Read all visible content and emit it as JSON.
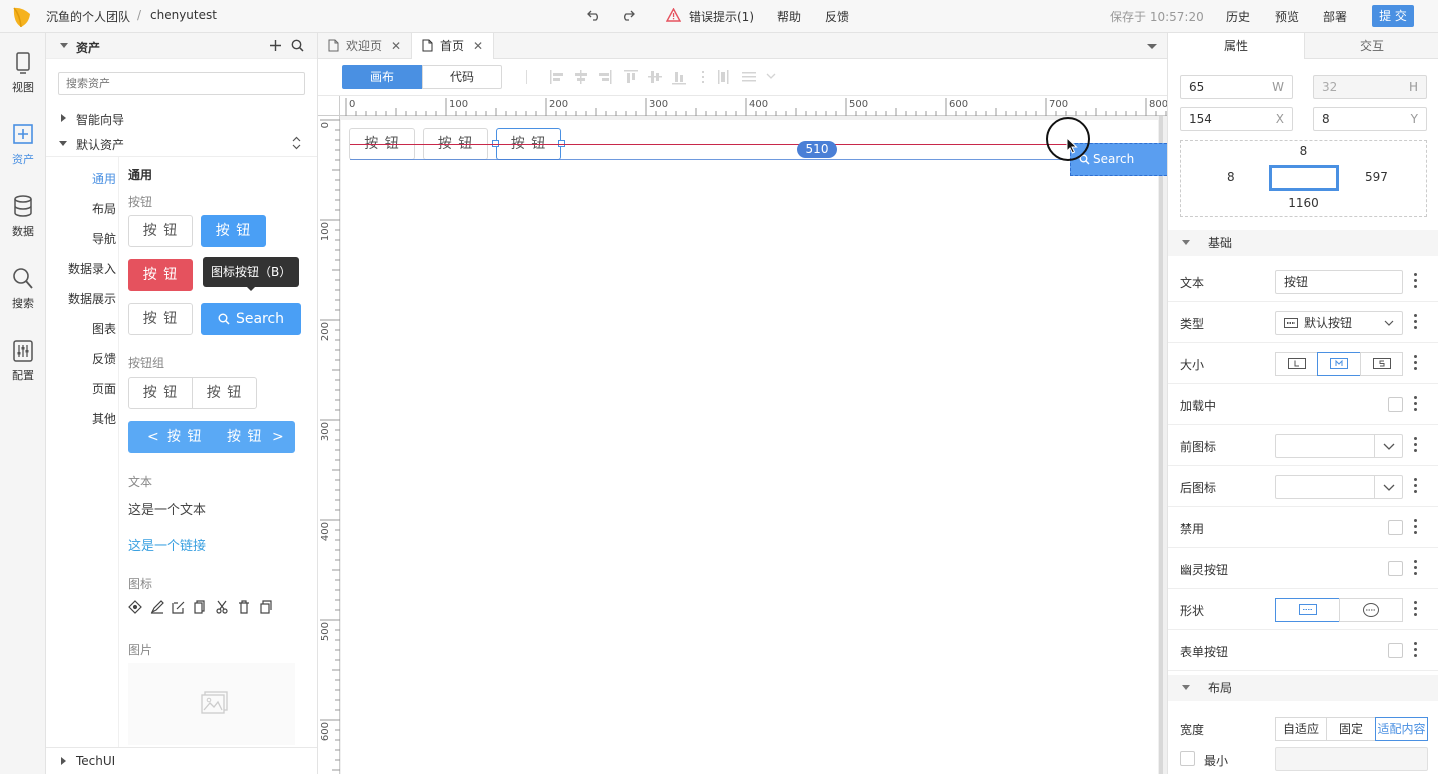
{
  "app": {
    "team": "沉鱼的个人团队",
    "separator": "/",
    "project": "chenyutest",
    "error_tip": "错误提示(1)",
    "help": "帮助",
    "feedback": "反馈",
    "saved_at": "保存于 10:57:20",
    "history": "历史",
    "preview": "预览",
    "deploy": "部署",
    "submit": "提 交"
  },
  "rail": [
    {
      "label": "视图",
      "icon": "view-icon"
    },
    {
      "label": "资产",
      "icon": "assets-icon"
    },
    {
      "label": "数据",
      "icon": "database-icon"
    },
    {
      "label": "搜索",
      "icon": "search-icon"
    },
    {
      "label": "配置",
      "icon": "settings-sliders-icon"
    }
  ],
  "assets": {
    "title": "资产",
    "search_placeholder": "搜索资产",
    "smart_guide": "智能向导",
    "default_assets": "默认资产",
    "categories": [
      "通用",
      "布局",
      "导航",
      "数据录入",
      "数据展示",
      "图表",
      "反馈",
      "页面",
      "其他"
    ],
    "section_title": "通用",
    "button_label": "按钮",
    "btn": "按 钮",
    "tooltip": "图标按钮（B）",
    "search_btn": "Search",
    "button_group_label": "按钮组",
    "text_label": "文本",
    "text_sample": "这是一个文本",
    "link_sample": "这是一个链接",
    "icon_label": "图标",
    "image_label": "图片",
    "techui": "TechUI"
  },
  "tabs": [
    {
      "label": "欢迎页"
    },
    {
      "label": "首页"
    }
  ],
  "mode": {
    "canvas": "画布",
    "code": "代码"
  },
  "ruler_h": [
    "0",
    "100",
    "200",
    "300",
    "400",
    "500",
    "600",
    "700",
    "800"
  ],
  "ruler_v": [
    "0",
    "100",
    "200",
    "300",
    "400",
    "500",
    "600"
  ],
  "canvas": {
    "btn": "按 钮",
    "distance_badge": "510",
    "drag_label": "Search"
  },
  "props": {
    "tab_props": "属性",
    "tab_interact": "交互",
    "w": "65",
    "w_unit": "W",
    "h": "32",
    "h_unit": "H",
    "x": "154",
    "x_unit": "X",
    "y": "8",
    "y_unit": "Y",
    "box_top": "8",
    "box_left": "8",
    "box_right": "597",
    "box_bottom": "1160",
    "group_basic": "基础",
    "text_label": "文本",
    "text_value": "按钮",
    "type_label": "类型",
    "type_value": "默认按钮",
    "size_label": "大小",
    "loading_label": "加载中",
    "prefix_icon_label": "前图标",
    "suffix_icon_label": "后图标",
    "disabled_label": "禁用",
    "ghost_label": "幽灵按钮",
    "shape_label": "形状",
    "form_button_label": "表单按钮",
    "group_layout": "布局",
    "width_label": "宽度",
    "width_options": [
      "自适应",
      "固定",
      "适配内容"
    ],
    "min_label": "最小"
  },
  "colors": {
    "accent": "#4a90e2",
    "danger": "#e5525e",
    "primary_btn": "#4a9ff5"
  }
}
